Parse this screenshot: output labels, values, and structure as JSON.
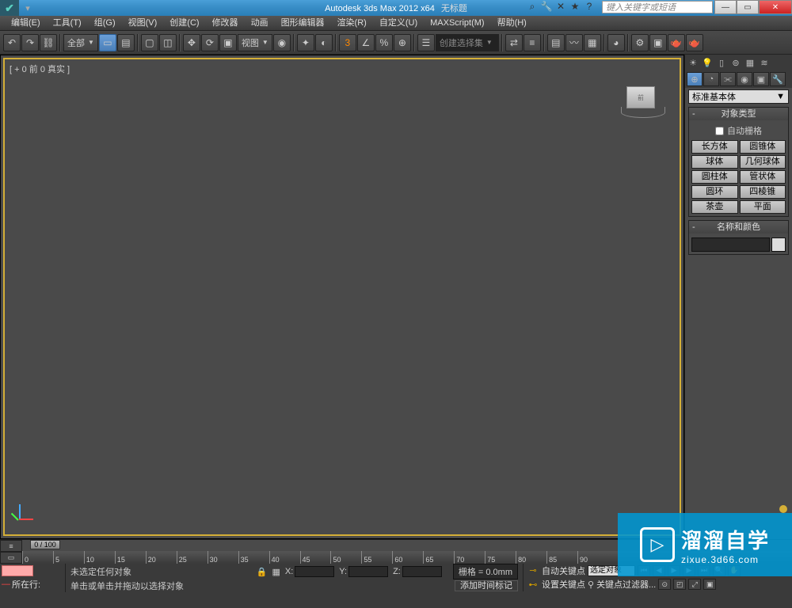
{
  "title": {
    "app": "Autodesk 3ds Max  2012 x64",
    "doc": "无标题"
  },
  "search_placeholder": "键入关键字或短语",
  "menu": [
    "编辑(E)",
    "工具(T)",
    "组(G)",
    "视图(V)",
    "创建(C)",
    "修改器",
    "动画",
    "图形编辑器",
    "渲染(R)",
    "自定义(U)",
    "MAXScript(M)",
    "帮助(H)"
  ],
  "toolbar": {
    "filter": "全部",
    "viewlabel": "视图",
    "three": "3",
    "selset_title": "创建选择集"
  },
  "viewport": {
    "label": "[ + 0 前 0 真实 ]"
  },
  "panel": {
    "category": "标准基本体",
    "rollout1": "对象类型",
    "autogrid": "自动栅格",
    "objects": [
      "长方体",
      "圆锥体",
      "球体",
      "几何球体",
      "圆柱体",
      "管状体",
      "圆环",
      "四棱锥",
      "茶壶",
      "平面"
    ],
    "rollout2": "名称和颜色"
  },
  "timeline": {
    "scrub": "0 / 100",
    "ticks": [
      0,
      5,
      10,
      15,
      20,
      25,
      30,
      35,
      40,
      45,
      50,
      55,
      60,
      65,
      70,
      75,
      80,
      85,
      90
    ]
  },
  "status": {
    "none_selected": "未选定任何对象",
    "hint": "单击或单击并拖动以选择对象",
    "loc": "所在行:",
    "addtag": "添加时间标记",
    "x": "X:",
    "y": "Y:",
    "z": "Z:",
    "grid": "栅格 = 0.0mm",
    "autokey": "自动关键点",
    "setkey": "设置关键点",
    "selset": "选定对象",
    "keyfilter": "关键点过滤器..."
  },
  "watermark": {
    "main": "溜溜自学",
    "sub": "zixue.3d66.com"
  }
}
